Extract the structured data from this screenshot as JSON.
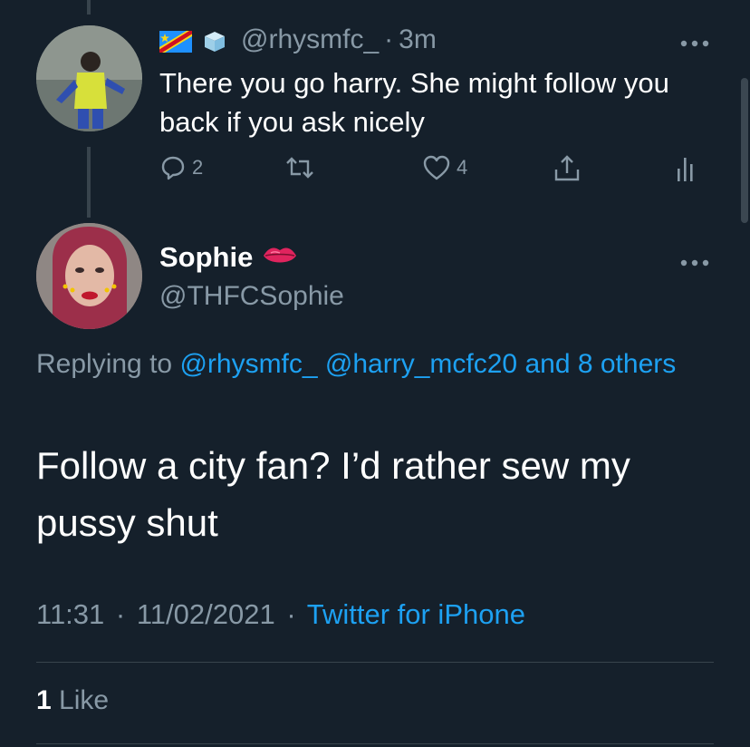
{
  "reply": {
    "handle": "@rhysmfc_",
    "separator": "·",
    "time": "3m",
    "text": "There you go harry. She might follow you back if you ask nicely",
    "reply_count": "2",
    "like_count": "4",
    "icons": [
      "dr-congo-flag-emoji",
      "ice-cube-emoji",
      "reply-icon",
      "retweet-icon",
      "like-icon",
      "share-icon",
      "analytics-icon",
      "more-icon"
    ]
  },
  "tweet": {
    "display_name": "Sophie",
    "handle": "@THFCSophie",
    "replying_prefix": "Replying to",
    "mentions": [
      "@rhysmfc_",
      "@harry_mcfc20"
    ],
    "and_others": "and 8 others",
    "text": "Follow a city fan? I’d rather sew my pussy shut",
    "time": "11:31",
    "date": "11/02/2021",
    "meta_sep": "·",
    "source": "Twitter for iPhone",
    "likes_count": "1",
    "likes_label": "Like",
    "icons": [
      "lips-emoji",
      "more-icon"
    ]
  },
  "colors": {
    "background": "#15202b",
    "text_primary": "#ffffff",
    "text_secondary": "#8899a6",
    "link": "#1da1f2",
    "border": "#38444d"
  }
}
